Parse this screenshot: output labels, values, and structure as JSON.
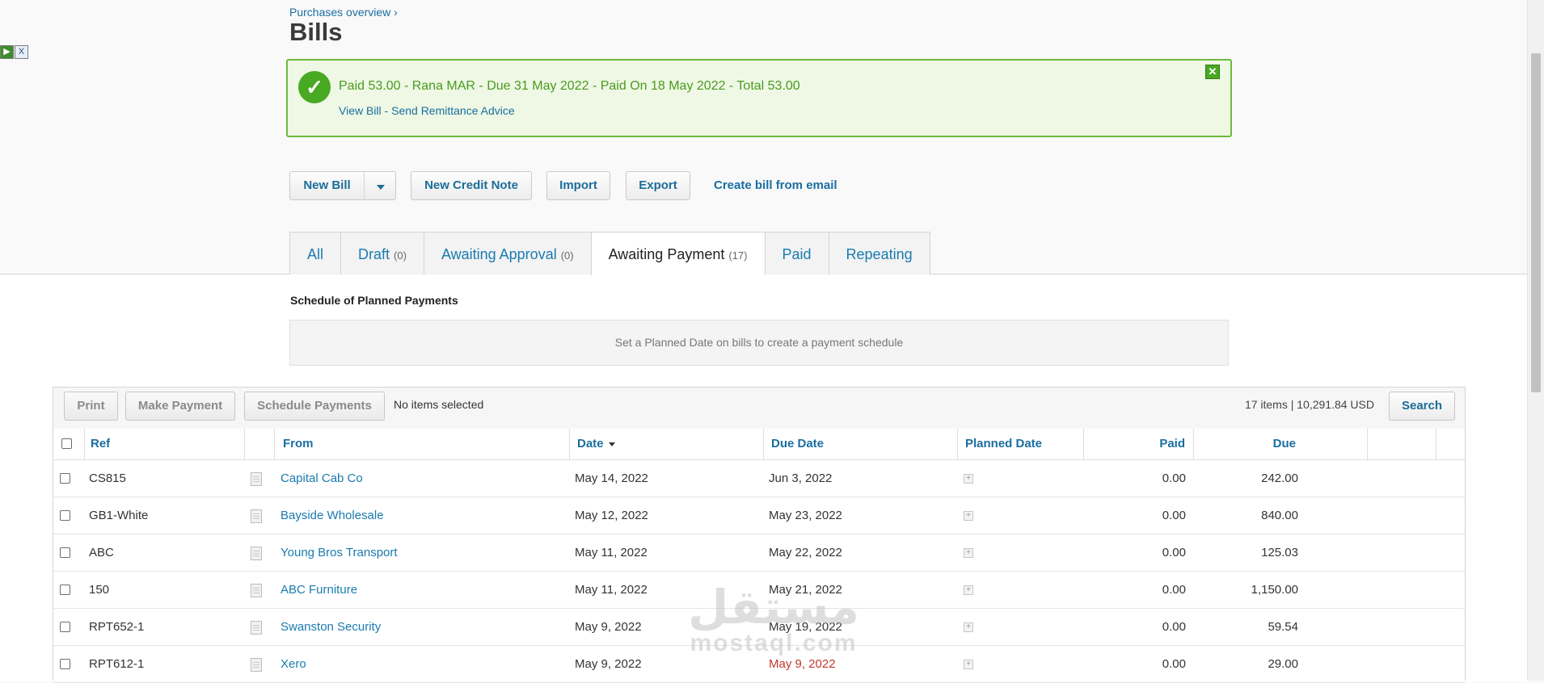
{
  "breadcrumb": {
    "parent": "Purchases overview",
    "separator": "›"
  },
  "page_title": "Bills",
  "alert": {
    "message": "Paid 53.00 - Rana MAR - Due 31 May 2022 - Paid On 18 May 2022 - Total 53.00",
    "view_bill": "View Bill",
    "link_separator": " - ",
    "send_remittance": "Send Remittance Advice",
    "close_glyph": "✕",
    "check_glyph": "✓"
  },
  "actions": {
    "new_bill": "New Bill",
    "new_credit_note": "New Credit Note",
    "import": "Import",
    "export": "Export",
    "create_from_email": "Create bill from email"
  },
  "tabs": [
    {
      "label": "All",
      "count": ""
    },
    {
      "label": "Draft",
      "count": "(0)"
    },
    {
      "label": "Awaiting Approval",
      "count": "(0)"
    },
    {
      "label": "Awaiting Payment",
      "count": "(17)"
    },
    {
      "label": "Paid",
      "count": ""
    },
    {
      "label": "Repeating",
      "count": ""
    }
  ],
  "schedule": {
    "title": "Schedule of Planned Payments",
    "empty_message": "Set a Planned Date on bills to create a payment schedule"
  },
  "toolbar": {
    "print": "Print",
    "make_payment": "Make Payment",
    "schedule_payments": "Schedule Payments",
    "status": "No items selected",
    "total": "17 items | 10,291.84 USD",
    "search": "Search"
  },
  "columns": {
    "ref": "Ref",
    "from": "From",
    "date": "Date",
    "due_date": "Due Date",
    "planned_date": "Planned Date",
    "paid": "Paid",
    "due": "Due"
  },
  "rows": [
    {
      "ref": "CS815",
      "from": "Capital Cab Co",
      "date": "May 14, 2022",
      "due_date": "Jun 3, 2022",
      "paid": "0.00",
      "due": "242.00",
      "overdue": false
    },
    {
      "ref": "GB1-White",
      "from": "Bayside Wholesale",
      "date": "May 12, 2022",
      "due_date": "May 23, 2022",
      "paid": "0.00",
      "due": "840.00",
      "overdue": false
    },
    {
      "ref": "ABC",
      "from": "Young Bros Transport",
      "date": "May 11, 2022",
      "due_date": "May 22, 2022",
      "paid": "0.00",
      "due": "125.03",
      "overdue": false
    },
    {
      "ref": "150",
      "from": "ABC Furniture",
      "date": "May 11, 2022",
      "due_date": "May 21, 2022",
      "paid": "0.00",
      "due": "1,150.00",
      "overdue": false
    },
    {
      "ref": "RPT652-1",
      "from": "Swanston Security",
      "date": "May 9, 2022",
      "due_date": "May 19, 2022",
      "paid": "0.00",
      "due": "59.54",
      "overdue": false
    },
    {
      "ref": "RPT612-1",
      "from": "Xero",
      "date": "May 9, 2022",
      "due_date": "May 9, 2022",
      "paid": "0.00",
      "due": "29.00",
      "overdue": true
    }
  ],
  "watermark": {
    "arabic": "مستقل",
    "latin": "mostaql.com"
  },
  "mini_icons": [
    "play-icon",
    "close-icon"
  ],
  "colors": {
    "link": "#1a6ea0",
    "success": "#48a923",
    "overdue": "#c0392b"
  }
}
